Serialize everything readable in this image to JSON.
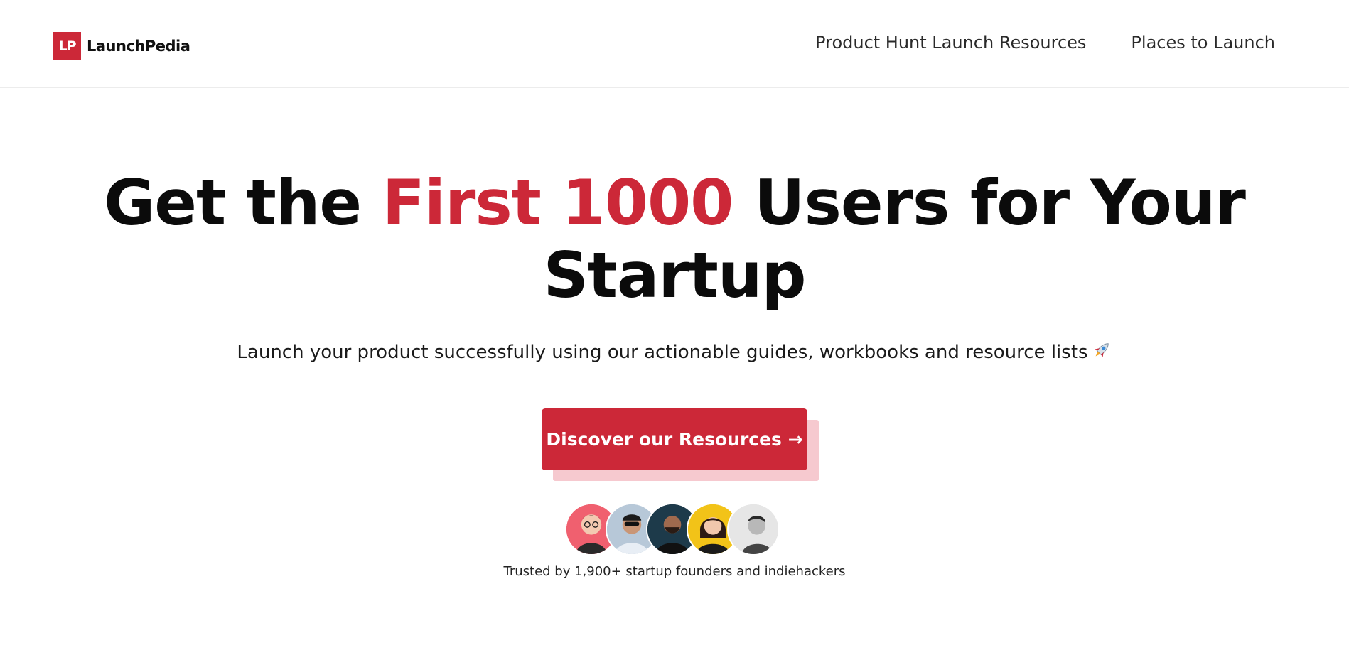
{
  "brand": {
    "logo_mark": "LP",
    "name": "LaunchPedia",
    "accent_color": "#cc2838"
  },
  "nav": {
    "items": [
      {
        "label": "Product Hunt Launch Resources"
      },
      {
        "label": "Places to Launch"
      }
    ]
  },
  "hero": {
    "title_part1": "Get the ",
    "title_highlight": "First 1000",
    "title_part2": " Users for Your Startup",
    "subtitle": "Launch your product successfully using our actionable guides, workbooks and resource lists",
    "subtitle_icon": "rocket-icon",
    "cta_label": "Discover our Resources →",
    "cta_shadow_color": "#f6c9cf"
  },
  "social_proof": {
    "avatars": [
      {
        "name": "avatar-1",
        "bg": "#f0606f"
      },
      {
        "name": "avatar-2",
        "bg": "#b7c8d8"
      },
      {
        "name": "avatar-3",
        "bg": "#1d3a4a"
      },
      {
        "name": "avatar-4",
        "bg": "#f2c318"
      },
      {
        "name": "avatar-5",
        "bg": "#d8d8d8"
      }
    ],
    "text": "Trusted by 1,900+ startup founders and indiehackers"
  }
}
